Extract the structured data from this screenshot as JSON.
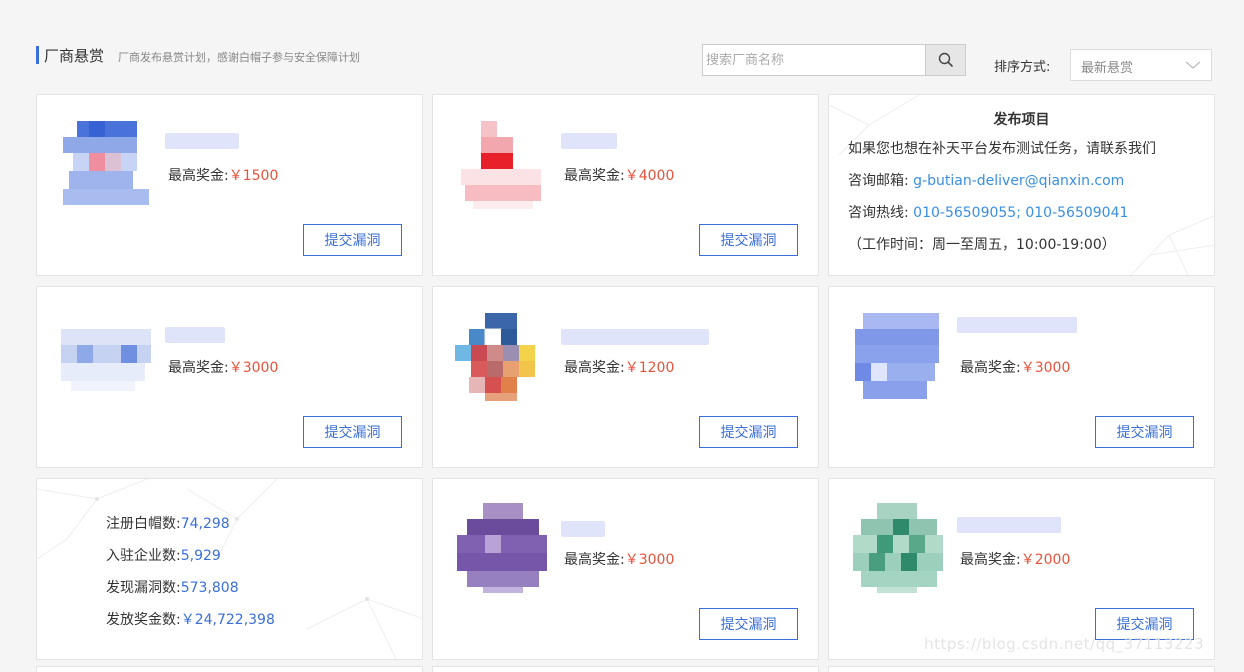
{
  "header": {
    "title": "厂商悬赏",
    "subtitle": "厂商发布悬赏计划，感谢白帽子参与安全保障计划",
    "search_placeholder": "搜索厂商名称",
    "search_icon": "search-icon",
    "sort_label": "排序方式:",
    "sort_value": "最新悬赏",
    "sort_icon": "chevron-down-icon"
  },
  "colors": {
    "accent": "#3a6fd8",
    "reward": "#e8523b",
    "link": "#3a8fe0"
  },
  "cards": [
    {
      "reward_label": "最高奖金:",
      "reward_amount": "￥1500",
      "button": "提交漏洞"
    },
    {
      "reward_label": "最高奖金:",
      "reward_amount": "￥4000",
      "button": "提交漏洞"
    },
    {
      "reward_label": "最高奖金:",
      "reward_amount": "￥3000",
      "button": "提交漏洞"
    },
    {
      "reward_label": "最高奖金:",
      "reward_amount": "￥1200",
      "button": "提交漏洞"
    },
    {
      "reward_label": "最高奖金:",
      "reward_amount": "￥3000",
      "button": "提交漏洞"
    },
    {
      "reward_label": "最高奖金:",
      "reward_amount": "￥3000",
      "button": "提交漏洞"
    },
    {
      "reward_label": "最高奖金:",
      "reward_amount": "￥2000",
      "button": "提交漏洞"
    }
  ],
  "publish": {
    "title": "发布项目",
    "desc": "如果您也想在补天平台发布测试任务，请联系我们",
    "email_label": "咨询邮箱:",
    "email": "g-butian-deliver@qianxin.com",
    "phone_label": "咨询热线:",
    "phone": "010-56509055; 010-56509041",
    "hours": "（工作时间：周一至周五，10:00-19:00）"
  },
  "stats": [
    {
      "label": "注册白帽数:",
      "value": "74,298"
    },
    {
      "label": "入驻企业数:",
      "value": "5,929"
    },
    {
      "label": "发现漏洞数:",
      "value": "573,808"
    },
    {
      "label": "发放奖金数:",
      "value": "￥24,722,398"
    }
  ],
  "watermark": "https://blog.csdn.net/qq_37113223"
}
